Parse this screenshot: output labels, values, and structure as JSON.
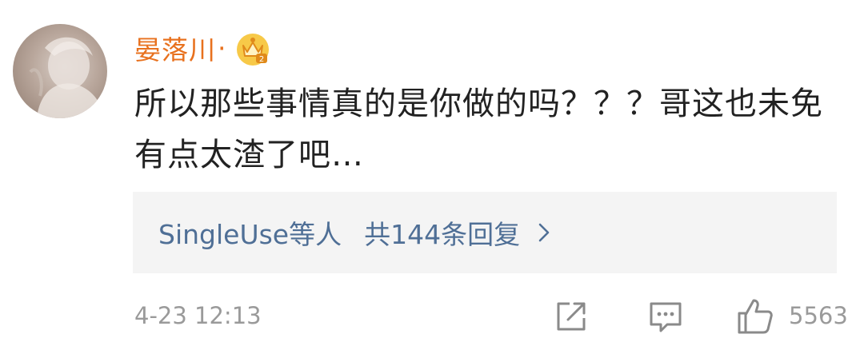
{
  "comment": {
    "username": "晏落川",
    "username_suffix": "·",
    "badge_icon": "vip-crown-badge-icon",
    "text": "所以那些事情真的是你做的吗？？？哥这也未免有点太渣了吧…",
    "replies": {
      "users_text": "SingleUse等人",
      "count_text": "共144条回复",
      "chevron_icon": "chevron-right-icon"
    },
    "timestamp": "4-23 12:13",
    "actions": {
      "share_icon": "share-icon",
      "comment_icon": "comment-icon",
      "like_icon": "thumbs-up-icon",
      "like_count": "5563"
    }
  },
  "colors": {
    "username": "#e8711e",
    "link": "#4f6f96",
    "text": "#222222",
    "muted": "#9a9a9a",
    "reply_bg": "#f4f4f4"
  }
}
